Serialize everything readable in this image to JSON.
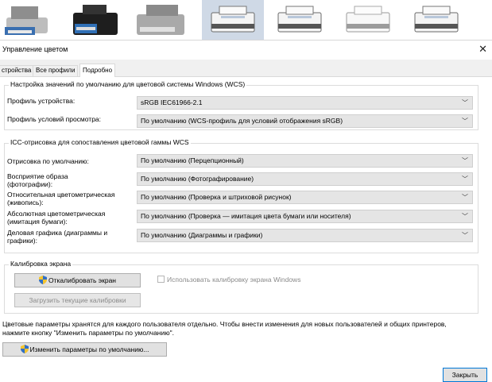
{
  "dialog": {
    "title": "Управление цветом",
    "close_icon": "close-icon"
  },
  "tabs": [
    {
      "label": "стройства",
      "active": false
    },
    {
      "label": "Все профили",
      "active": false
    },
    {
      "label": "Подробно",
      "active": true
    }
  ],
  "wcs_defaults": {
    "legend": "Настройка значений по умолчанию для цветовой системы Windows (WCS)",
    "device_profile_label": "Профиль устройства:",
    "device_profile_value": "sRGB IEC61966-2.1",
    "viewing_profile_label": "Профиль условий просмотра:",
    "viewing_profile_value": "По умолчанию (WCS-профиль для условий отображения sRGB)"
  },
  "icc_rendering": {
    "legend": "ICC-отрисовка для сопоставления цветовой гаммы WCS",
    "rows": [
      {
        "label": "Отрисовка по умолчанию:",
        "value": "По умолчанию (Перцепционный)"
      },
      {
        "label": "Восприятие образа\n(фотографии):",
        "value": "По умолчанию (Фотографирование)"
      },
      {
        "label": "Относительная цветометрическая\n(живопись):",
        "value": "По умолчанию (Проверка и штриховой рисунок)"
      },
      {
        "label": "Абсолютная цветометрическая\n(имитация бумаги):",
        "value": "По умолчанию (Проверка — имитация цвета бумаги или носителя)"
      },
      {
        "label": "Деловая графика (диаграммы и\nграфики):",
        "value": "По умолчанию (Диаграммы и графики)"
      }
    ]
  },
  "calibration": {
    "legend": "Калибровка экрана",
    "calibrate_button": "Откалибровать экран",
    "use_windows_calibration_label": "Использовать калибровку экрана Windows",
    "use_windows_calibration_checked": false,
    "load_current_button": "Загрузить текущие калибровки"
  },
  "footer": {
    "note": "Цветовые параметры хранятся для каждого пользователя отдельно. Чтобы внести изменения для новых пользователей и общих принтеров, нажмите кнопку \"Изменить параметры по умолчанию\".",
    "change_defaults_button": "Изменить параметры по умолчанию...",
    "close_button": "Закрыть"
  },
  "icons": {
    "shield": "uac-shield-icon",
    "chevron": "chevron-down-icon",
    "printer": "printer-icon"
  },
  "colors": {
    "selected_thumb": "#cfd9e6",
    "accent_border": "#0078d7",
    "dialog_bg": "#f0f0f0"
  }
}
